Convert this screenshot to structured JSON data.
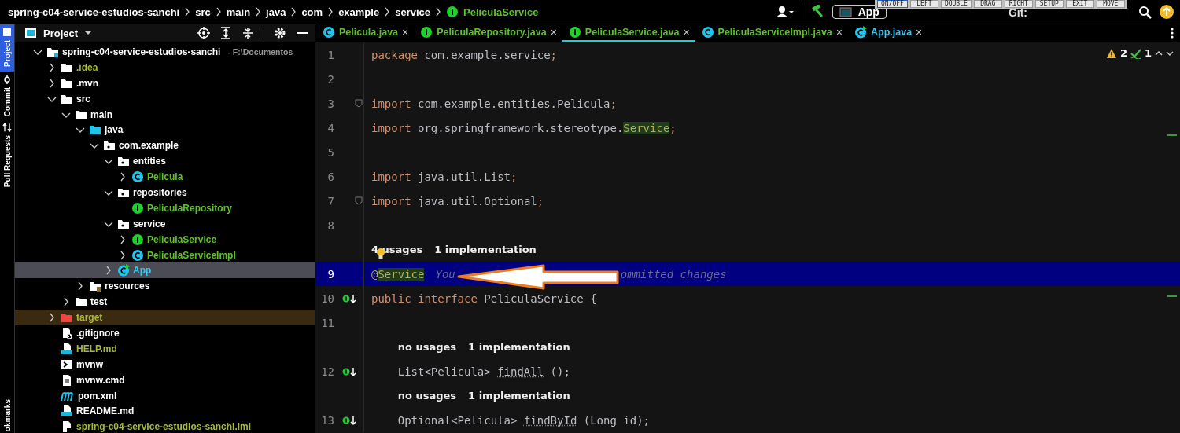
{
  "breadcrumb": [
    {
      "label": "spring-c04-service-estudios-sanchi",
      "kind": "text"
    },
    {
      "label": "src",
      "kind": "text"
    },
    {
      "label": "main",
      "kind": "text"
    },
    {
      "label": "java",
      "kind": "text"
    },
    {
      "label": "com",
      "kind": "text"
    },
    {
      "label": "example",
      "kind": "text"
    },
    {
      "label": "service",
      "kind": "text"
    },
    {
      "label": "PeliculaService",
      "kind": "interface"
    }
  ],
  "toolbar": {
    "run_config": "App",
    "git_label": "Git:"
  },
  "overlay_buttons": [
    {
      "label": "ON/OFF",
      "selected": true
    },
    {
      "label": "LEFT",
      "selected": false
    },
    {
      "label": "DOUBLE",
      "selected": false
    },
    {
      "label": "DRAG",
      "selected": false
    },
    {
      "label": "RIGHT",
      "selected": false
    },
    {
      "label": "SETUP",
      "selected": false
    },
    {
      "label": "EXIT",
      "selected": false
    },
    {
      "label": "MOVE",
      "selected": false
    }
  ],
  "tool_strip": [
    {
      "label": "Project",
      "selected": true,
      "kind": "project"
    },
    {
      "label": "Commit",
      "selected": false,
      "kind": "commit"
    },
    {
      "label": "Pull Requests",
      "selected": false,
      "kind": "pull"
    }
  ],
  "tool_strip_bottom": "okmarks",
  "project_panel": {
    "title": "Project",
    "tree": [
      {
        "label": "spring-c04-service-estudios-sanchi",
        "note": "- F:\\Documentos",
        "kind": "module",
        "expanded": true,
        "selected": false,
        "color": "#ffffff",
        "children": [
          {
            "label": ".idea",
            "kind": "folder",
            "expanded": false,
            "selected": false,
            "color": "#a8b93a"
          },
          {
            "label": ".mvn",
            "kind": "folder",
            "expanded": false,
            "selected": false,
            "color": "#ffffff"
          },
          {
            "label": "src",
            "kind": "folder",
            "expanded": true,
            "selected": false,
            "color": "#ffffff",
            "children": [
              {
                "label": "main",
                "kind": "folder",
                "expanded": true,
                "selected": false,
                "color": "#ffffff",
                "children": [
                  {
                    "label": "java",
                    "kind": "source",
                    "expanded": true,
                    "selected": false,
                    "color": "#ffffff",
                    "children": [
                      {
                        "label": "com.example",
                        "kind": "package",
                        "expanded": true,
                        "selected": false,
                        "color": "#ffffff",
                        "children": [
                          {
                            "label": "entities",
                            "kind": "package",
                            "expanded": true,
                            "selected": false,
                            "color": "#ffffff",
                            "children": [
                              {
                                "label": "Pelicula",
                                "kind": "class",
                                "expanded": false,
                                "selected": false,
                                "color": "#5fc02f"
                              }
                            ]
                          },
                          {
                            "label": "repositories",
                            "kind": "package",
                            "expanded": true,
                            "selected": false,
                            "color": "#ffffff",
                            "children": [
                              {
                                "label": "PeliculaRepository",
                                "kind": "interface",
                                "selected": false,
                                "color": "#5fc02f"
                              }
                            ]
                          },
                          {
                            "label": "service",
                            "kind": "package",
                            "expanded": true,
                            "selected": false,
                            "color": "#ffffff",
                            "children": [
                              {
                                "label": "PeliculaService",
                                "kind": "interface",
                                "expanded": false,
                                "selected": false,
                                "color": "#5fc02f"
                              },
                              {
                                "label": "PeliculaServiceImpl",
                                "kind": "class",
                                "expanded": false,
                                "selected": false,
                                "color": "#5fc02f"
                              }
                            ]
                          },
                          {
                            "label": "App",
                            "kind": "app",
                            "expanded": false,
                            "selected": true,
                            "color": "#35c8f5"
                          }
                        ]
                      }
                    ]
                  },
                  {
                    "label": "resources",
                    "kind": "resources",
                    "expanded": false,
                    "selected": false,
                    "color": "#ffffff"
                  }
                ]
              },
              {
                "label": "test",
                "kind": "folder",
                "expanded": false,
                "selected": false,
                "color": "#ffffff"
              }
            ]
          },
          {
            "label": "target",
            "kind": "excluded",
            "expanded": false,
            "selected": false,
            "color": "#a8b93a"
          },
          {
            "label": ".gitignore",
            "kind": "ignore-file",
            "selected": false,
            "color": "#ffffff"
          },
          {
            "label": "HELP.md",
            "kind": "markdown",
            "selected": false,
            "color": "#a8b93a"
          },
          {
            "label": "mvnw",
            "kind": "script",
            "selected": false,
            "color": "#ffffff"
          },
          {
            "label": "mvnw.cmd",
            "kind": "text-file",
            "selected": false,
            "color": "#ffffff"
          },
          {
            "label": "pom.xml",
            "kind": "maven",
            "selected": false,
            "color": "#ffffff"
          },
          {
            "label": "README.md",
            "kind": "markdown",
            "selected": false,
            "color": "#ffffff"
          },
          {
            "label": "spring-c04-service-estudios-sanchi.iml",
            "kind": "module-file",
            "selected": false,
            "color": "#a8b93a"
          }
        ]
      }
    ]
  },
  "tabs": [
    {
      "label": "Pelicula.java",
      "kind": "class",
      "close": "×",
      "selected": false,
      "color": "#5fc02f"
    },
    {
      "label": "PeliculaRepository.java",
      "kind": "interface",
      "close": "×",
      "selected": false,
      "color": "#5fc02f"
    },
    {
      "label": "PeliculaService.java",
      "kind": "interface",
      "close": "×",
      "selected": true,
      "color": "#5fc02f"
    },
    {
      "label": "PeliculaServiceImpl.java",
      "kind": "class",
      "close": "×",
      "selected": false,
      "color": "#5fc02f"
    },
    {
      "label": "App.java",
      "kind": "app",
      "close": "×",
      "selected": false,
      "color": "#35c8f5"
    }
  ],
  "inspections": {
    "warnings": "2",
    "weak_warnings": "1"
  },
  "editor": {
    "lines": [
      {
        "kind": "code",
        "number": "1",
        "current": false,
        "tokens": [
          {
            "text": "package ",
            "kind": "keyword"
          },
          {
            "text": "com.example.service",
            "kind": "plain"
          },
          {
            "text": ";",
            "kind": "keyword"
          }
        ]
      },
      {
        "kind": "code",
        "number": "2",
        "current": false
      },
      {
        "kind": "code",
        "number": "3",
        "current": false,
        "gutter": {
          "kind": "fold"
        },
        "tokens": [
          {
            "text": "import ",
            "kind": "keyword"
          },
          {
            "text": "com.example.entities.Pelicula",
            "kind": "plain"
          },
          {
            "text": ";",
            "kind": "keyword"
          }
        ]
      },
      {
        "kind": "code",
        "number": "4",
        "current": false,
        "tokens": [
          {
            "text": "import ",
            "kind": "keyword"
          },
          {
            "text": "org.springframework.stereotype.",
            "kind": "plain"
          },
          {
            "text": "Service",
            "kind": "highlight"
          },
          {
            "text": ";",
            "kind": "keyword"
          }
        ]
      },
      {
        "kind": "code",
        "number": "5",
        "current": false
      },
      {
        "kind": "code",
        "number": "6",
        "current": false,
        "tokens": [
          {
            "text": "import ",
            "kind": "keyword"
          },
          {
            "text": "java.util.List",
            "kind": "plain"
          },
          {
            "text": ";",
            "kind": "keyword"
          }
        ]
      },
      {
        "kind": "code",
        "number": "7",
        "current": false,
        "gutter": {
          "kind": "fold"
        },
        "tokens": [
          {
            "text": "import ",
            "kind": "keyword"
          },
          {
            "text": "java.util.Optional",
            "kind": "plain"
          },
          {
            "text": ";",
            "kind": "keyword"
          }
        ]
      },
      {
        "kind": "code",
        "number": "8",
        "current": false
      },
      {
        "kind": "hint",
        "parts": [
          "4 usages",
          "1 implementation"
        ]
      },
      {
        "kind": "code",
        "number": "9",
        "current": true,
        "tokens": [
          {
            "text": "@",
            "kind": "annotation"
          },
          {
            "text": "Service",
            "kind": "highlight"
          }
        ],
        "blame": [
          "You",
          "ommitted changes"
        ]
      },
      {
        "kind": "code",
        "number": "10",
        "current": false,
        "gutter": {
          "kind": "implemented"
        },
        "tokens": [
          {
            "text": "public interface ",
            "kind": "keyword"
          },
          {
            "text": "PeliculaService",
            "kind": "plain"
          },
          {
            "text": " {",
            "kind": "plain"
          }
        ]
      },
      {
        "kind": "code",
        "number": "11",
        "current": false
      },
      {
        "kind": "hint",
        "parts": [
          "no usages",
          "1 implementation"
        ]
      },
      {
        "kind": "code",
        "number": "12",
        "current": false,
        "gutter": {
          "kind": "implemented"
        },
        "tokens": [
          {
            "text": "    List<Pelicula> ",
            "kind": "plain"
          },
          {
            "text": "findAll",
            "kind": "unused"
          },
          {
            "text": " ();",
            "kind": "plain"
          }
        ]
      },
      {
        "kind": "hint",
        "parts": [
          "no usages",
          "1 implementation"
        ]
      },
      {
        "kind": "code",
        "number": "13",
        "current": false,
        "gutter": {
          "kind": "implemented"
        },
        "tokens": [
          {
            "text": "    Optional<Pelicula> ",
            "kind": "plain"
          },
          {
            "text": "findById",
            "kind": "unused"
          },
          {
            "text": " (Long id);",
            "kind": "plain"
          }
        ]
      }
    ]
  }
}
